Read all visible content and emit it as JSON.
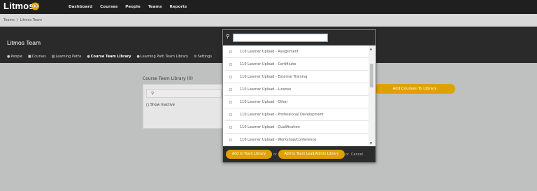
{
  "app": {
    "brand": "Litmos"
  },
  "topnav": [
    "Dashboard",
    "Courses",
    "People",
    "Teams",
    "Reports"
  ],
  "breadcrumb": [
    "Teams",
    "/",
    "Litmos Team"
  ],
  "team": {
    "name": "Litmos Team",
    "tabs": [
      {
        "icon": "person-icon",
        "label": "People"
      },
      {
        "icon": "courses-icon",
        "label": "Courses"
      },
      {
        "icon": "learning-path-icon",
        "label": "Learning Paths"
      },
      {
        "icon": "team-library-icon",
        "label": "Course Team Library"
      },
      {
        "icon": "team-library-icon",
        "label": "Learning Path Team Library"
      },
      {
        "icon": "gear-icon",
        "label": "Settings"
      }
    ]
  },
  "library": {
    "title": "Course Team Library (0)",
    "show_inactive": "Show Inactive",
    "add_button": "Add Courses To Library"
  },
  "modal": {
    "search_value": "",
    "items": [
      "110 Learner Upload - Assignment",
      "110 Learner Upload - Certificate",
      "110 Learner Upload - External Training",
      "110 Learner Upload - License",
      "110 Learner Upload - Other",
      "110 Learner Upload - Professional Development",
      "110 Learner Upload - Qualification",
      "110 Learner Upload - Workshop/Conference"
    ],
    "add_team_library": "Add to Team Library",
    "or": "or",
    "add_team_lead": "Add to Team Lead/Admin Library",
    "or_cancel": "or",
    "cancel": "Cancel"
  },
  "colors": {
    "accent": "#e0a100",
    "dark": "#2a2a2a"
  }
}
